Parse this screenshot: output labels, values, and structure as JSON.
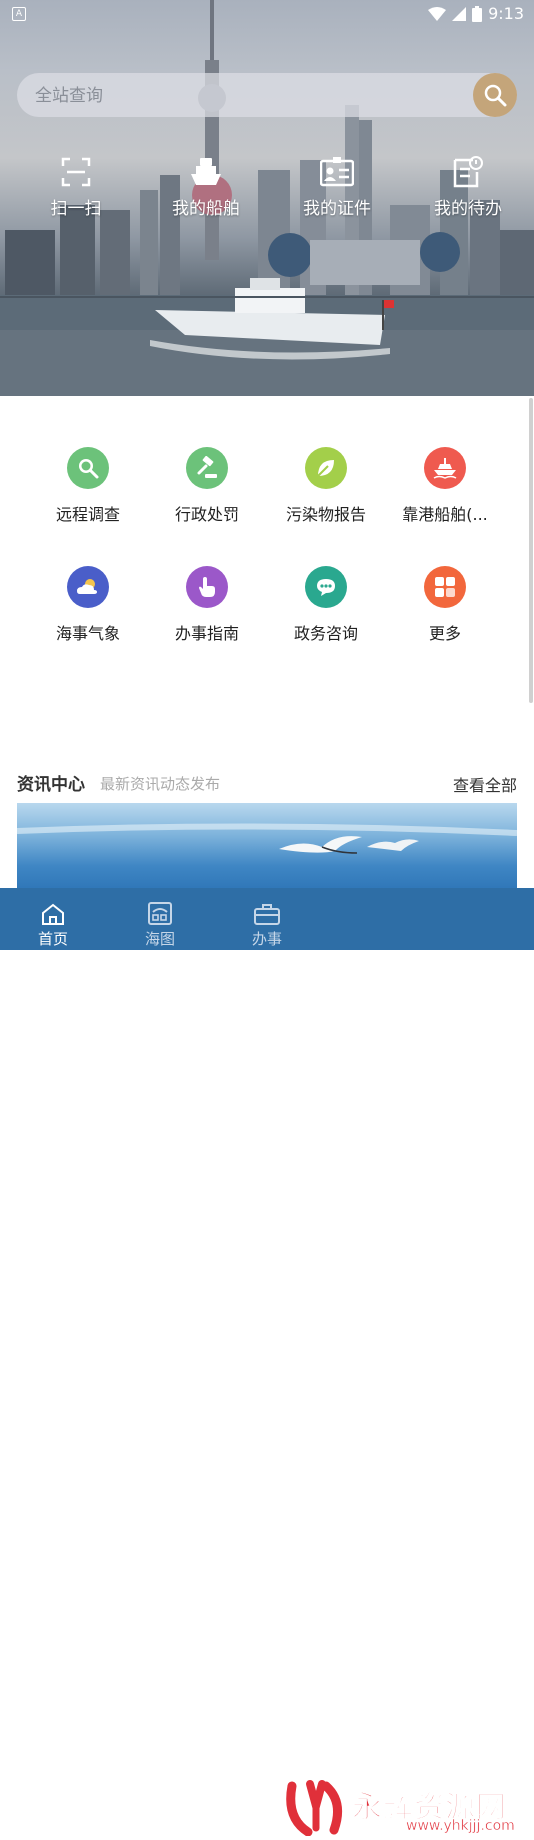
{
  "status_bar": {
    "indicator": "A",
    "time": "9:13"
  },
  "search": {
    "placeholder": "全站查询",
    "icon": "search-icon"
  },
  "quick_actions": [
    {
      "label": "扫一扫",
      "icon": "scan-icon"
    },
    {
      "label": "我的船舶",
      "icon": "ship-icon"
    },
    {
      "label": "我的证件",
      "icon": "id-card-icon"
    },
    {
      "label": "我的待办",
      "icon": "todo-icon"
    }
  ],
  "services": [
    {
      "label": "远程调查",
      "icon": "magnifier-icon",
      "color": "#6cc27a"
    },
    {
      "label": "行政处罚",
      "icon": "gavel-icon",
      "color": "#6cc27a"
    },
    {
      "label": "污染物报告",
      "icon": "leaf-icon",
      "color": "#a3cf4a"
    },
    {
      "label": "靠港船舶(...",
      "icon": "vessel-icon",
      "color": "#ef5a4f"
    },
    {
      "label": "海事气象",
      "icon": "weather-icon",
      "color": "#4a5ec9"
    },
    {
      "label": "办事指南",
      "icon": "pointer-hand-icon",
      "color": "#9b58c9"
    },
    {
      "label": "政务咨询",
      "icon": "chat-icon",
      "color": "#2aa88f"
    },
    {
      "label": "更多",
      "icon": "grid-more-icon",
      "color": "#f2673c"
    }
  ],
  "news": {
    "title": "资讯中心",
    "subtitle": "最新资讯动态发布",
    "view_all": "查看全部"
  },
  "tabs": [
    {
      "label": "首页",
      "icon": "home-icon",
      "active": true
    },
    {
      "label": "海图",
      "icon": "chart-map-icon",
      "active": false
    },
    {
      "label": "办事",
      "icon": "briefcase-icon",
      "active": false
    }
  ],
  "watermark": {
    "text": "永辉资源网",
    "url": "www.yhkjjj.com"
  }
}
